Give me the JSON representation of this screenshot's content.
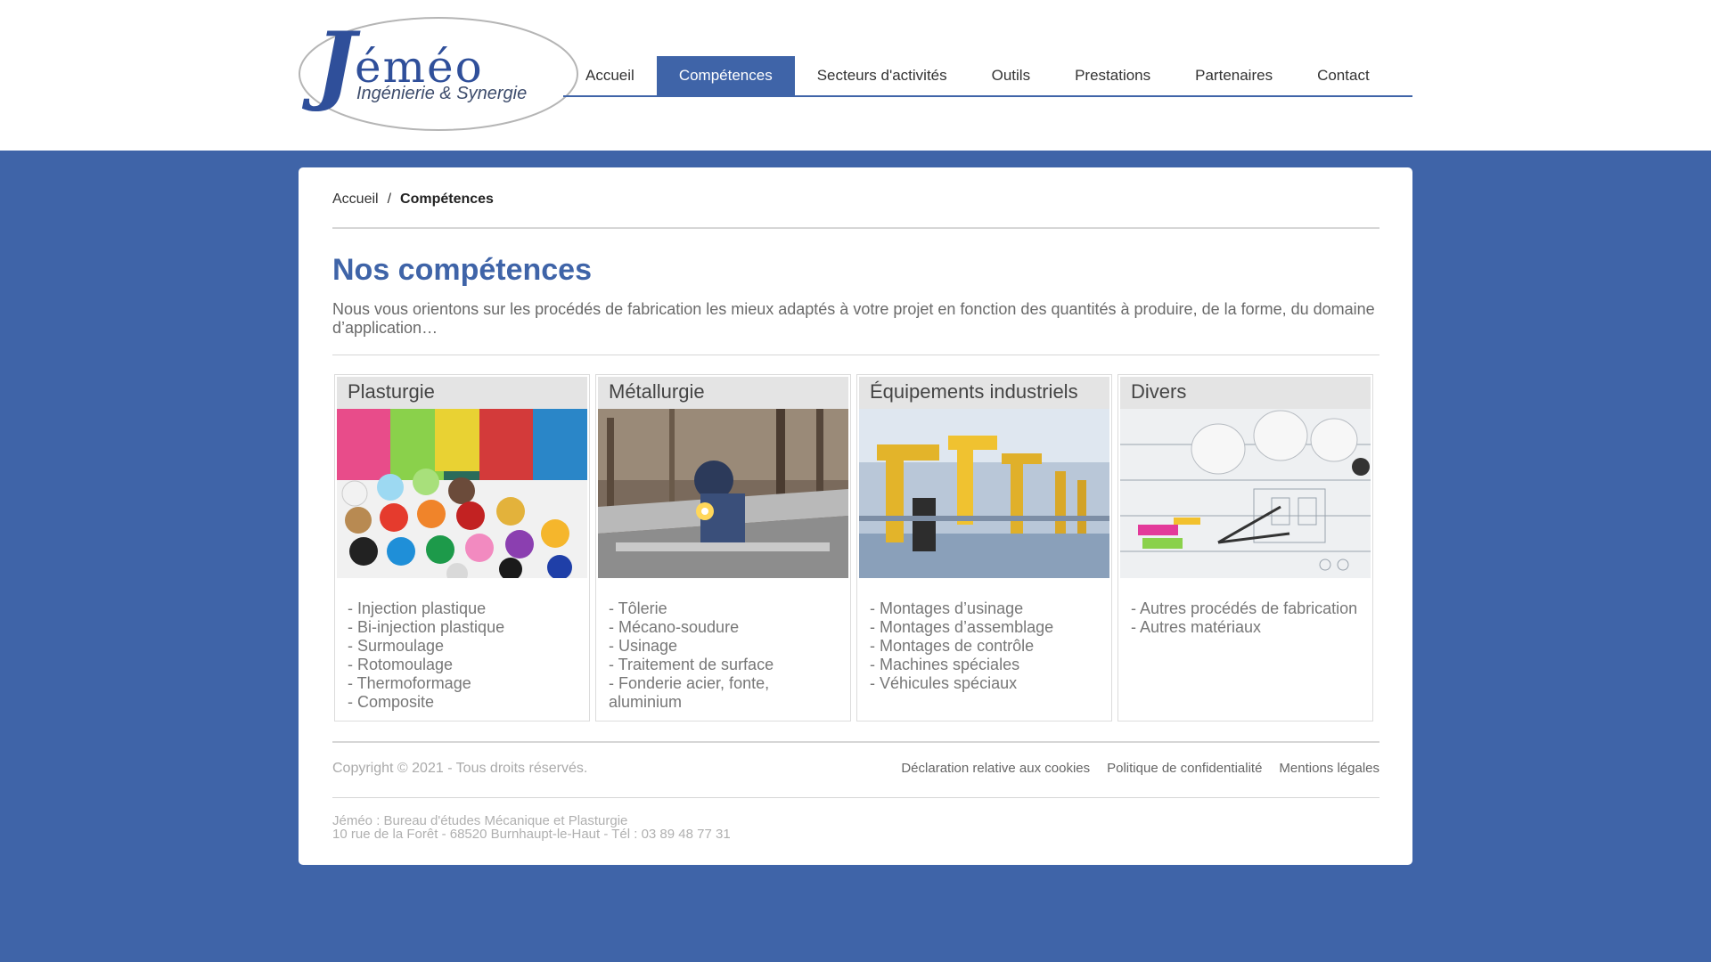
{
  "brand": {
    "name_letter": "J",
    "name_rest": "éméo",
    "tagline": "Ingénierie & Synergie"
  },
  "nav": {
    "items": [
      {
        "label": "Accueil",
        "active": false
      },
      {
        "label": "Compétences",
        "active": true
      },
      {
        "label": "Secteurs d'activités",
        "active": false
      },
      {
        "label": "Outils",
        "active": false
      },
      {
        "label": "Prestations",
        "active": false
      },
      {
        "label": "Partenaires",
        "active": false
      },
      {
        "label": "Contact",
        "active": false
      }
    ]
  },
  "breadcrumb": {
    "home": "Accueil",
    "separator": "/",
    "current": "Compétences"
  },
  "main": {
    "title": "Nos compétences",
    "intro": "Nous vous orientons sur les procédés de fabrication les mieux adaptés à votre projet en fonction des quantités à produire, de la forme, du domaine d’application…"
  },
  "categories": [
    {
      "title": "Plasturgie",
      "image_icon": "plastic-pellets-image",
      "items": [
        "- Injection plastique",
        "- Bi-injection plastique",
        "- Surmoulage",
        "- Rotomoulage",
        "- Thermoformage",
        "- Composite"
      ]
    },
    {
      "title": "Métallurgie",
      "image_icon": "welding-image",
      "items": [
        "- Tôlerie",
        "- Mécano-soudure",
        "- Usinage",
        "- Traitement de surface",
        "- Fonderie acier, fonte, aluminium"
      ]
    },
    {
      "title": "Équipements industriels",
      "image_icon": "robot-assembly-line-image",
      "items": [
        "- Montages d’usinage",
        "- Montages d’assemblage",
        "- Montages de contrôle",
        "- Machines spéciales",
        "- Véhicules spéciaux"
      ]
    },
    {
      "title": "Divers",
      "image_icon": "technical-drawings-image",
      "items": [
        "- Autres procédés de fabrication",
        "- Autres matériaux"
      ]
    }
  ],
  "footer": {
    "copyright": "Copyright © 2021 - Tous droits réservés.",
    "links": [
      "Déclaration relative aux cookies",
      "Politique de confidentialité",
      "Mentions légales"
    ],
    "address_line1": "Jéméo : Bureau d'études Mécanique et Plasturgie",
    "address_line2": "10 rue de la Forêt - 68520 Burnhaupt-le-Haut - Tél : 03 89 48 77 31"
  },
  "colors": {
    "primary": "#3f64a8",
    "background": "#3f64a8",
    "card": "#ffffff",
    "box_header": "#e4e4e4"
  }
}
